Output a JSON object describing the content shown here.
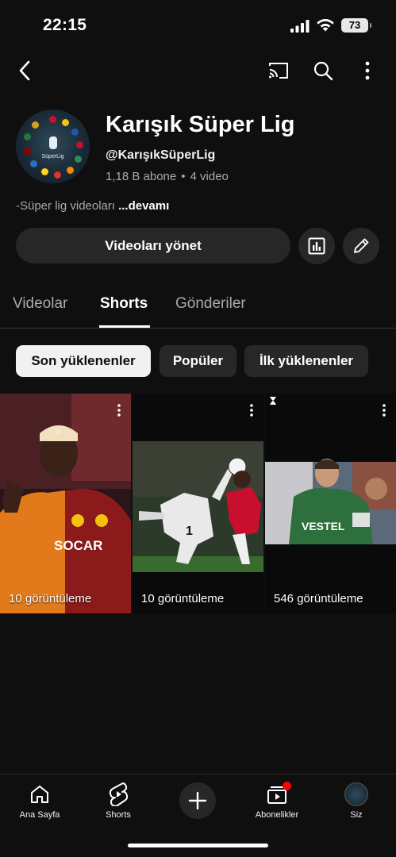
{
  "status_bar": {
    "time": "22:15",
    "battery": "73"
  },
  "channel": {
    "name": "Karışık Süper Lig",
    "handle": "@KarışıkSüperLig",
    "subscribers": "1,18 B abone",
    "separator": "•",
    "video_count": "4 video",
    "description": "-Süper lig videoları",
    "more_label": "...devamı",
    "avatar_text": "SüperLig"
  },
  "actions": {
    "manage_label": "Videoları yönet"
  },
  "tabs": [
    {
      "label": "Videolar",
      "active": false
    },
    {
      "label": "Shorts",
      "active": true
    },
    {
      "label": "Gönderiler",
      "active": false
    }
  ],
  "chips": [
    {
      "label": "Son yüklenenler",
      "active": true
    },
    {
      "label": "Popüler",
      "active": false
    },
    {
      "label": "İlk yüklenenler",
      "active": false
    }
  ],
  "shorts": [
    {
      "views": "10 görüntüleme"
    },
    {
      "views": "10 görüntüleme"
    },
    {
      "views": "546 görüntüleme"
    }
  ],
  "bottom_nav": [
    {
      "label": "Ana Sayfa",
      "icon": "home-icon"
    },
    {
      "label": "Shorts",
      "icon": "shorts-icon"
    },
    {
      "label": "",
      "icon": "plus-icon"
    },
    {
      "label": "Abonelikler",
      "icon": "subscriptions-icon"
    },
    {
      "label": "Siz",
      "icon": "profile-avatar"
    }
  ],
  "colors": {
    "background": "#0f0f0f",
    "surface": "#272727",
    "secondary_text": "#aaaaaa",
    "accent_red": "#ff0000"
  }
}
